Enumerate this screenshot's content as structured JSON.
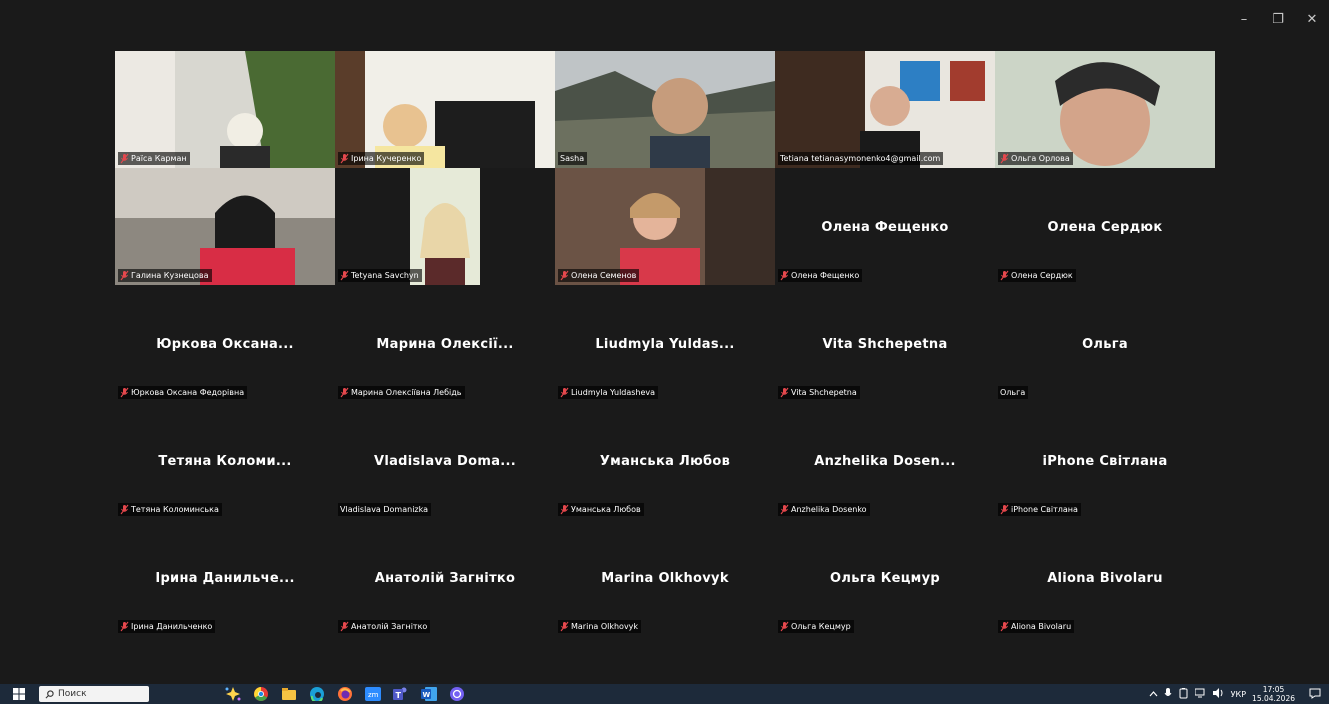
{
  "window_controls": {
    "minimize": "–",
    "restore": "❐",
    "close": "✕"
  },
  "tiles": [
    {
      "label": "Раїса Карман",
      "video": true,
      "muted": true
    },
    {
      "label": "Ірина Кучеренко",
      "video": true,
      "muted": true
    },
    {
      "label": "Sasha",
      "video": true,
      "muted": false,
      "active": true
    },
    {
      "label": "Tetiana tetianasymonenko4@gmail.com",
      "video": true,
      "muted": false
    },
    {
      "label": "Ольга Орлова",
      "video": true,
      "muted": true
    },
    {
      "label": "Галина Кузнецова",
      "video": true,
      "muted": true
    },
    {
      "label": "Tetyana Savchyn",
      "video": true,
      "muted": true
    },
    {
      "label": "Олена Семенов",
      "video": true,
      "muted": true
    },
    {
      "label": "Олена Фещенко",
      "display": "Олена Фещенко",
      "video": false,
      "muted": true
    },
    {
      "label": "Олена Сердюк",
      "display": "Олена Сердюк",
      "video": false,
      "muted": true
    },
    {
      "label": "Юркова Оксана Федорівна",
      "display": "Юркова Оксана...",
      "video": false,
      "muted": true
    },
    {
      "label": "Марина Олексіївна Лебідь",
      "display": "Марина Олексії...",
      "video": false,
      "muted": true
    },
    {
      "label": "Liudmyla Yuldasheva",
      "display": "Liudmyla Yuldas...",
      "video": false,
      "muted": true
    },
    {
      "label": "Vita Shchepetna",
      "display": "Vita Shchepetna",
      "video": false,
      "muted": true
    },
    {
      "label": "Ольга",
      "display": "Ольга",
      "video": false,
      "muted": false
    },
    {
      "label": "Тетяна Коломинська",
      "display": "Тетяна Коломи...",
      "video": false,
      "muted": true
    },
    {
      "label": "Vladislava Domanizka",
      "display": "Vladislava Doma...",
      "video": false,
      "muted": false
    },
    {
      "label": "Уманська Любов",
      "display": "Уманська Любов",
      "video": false,
      "muted": true
    },
    {
      "label": "Anzhelika Dosenko",
      "display": "Anzhelika Dosen...",
      "video": false,
      "muted": true
    },
    {
      "label": "iPhone Світлана",
      "display": "iPhone Світлана",
      "video": false,
      "muted": true
    },
    {
      "label": "Ірина Данильченко",
      "display": "Ірина Данильче...",
      "video": false,
      "muted": true
    },
    {
      "label": "Анатолій Загнітко",
      "display": "Анатолій Загнітко",
      "video": false,
      "muted": true
    },
    {
      "label": "Marina Olkhovyk",
      "display": "Marina Olkhovyk",
      "video": false,
      "muted": true
    },
    {
      "label": "Ольга Кецмур",
      "display": "Ольга Кецмур",
      "video": false,
      "muted": true
    },
    {
      "label": "Aliona Bivolaru",
      "display": "Aliona Bivolaru",
      "video": false,
      "muted": true
    }
  ],
  "taskbar": {
    "search_placeholder": "Поиск",
    "apps": [
      "windows-start-icon",
      "copilot-icon",
      "chrome-icon",
      "file-explorer-icon",
      "edge-icon",
      "firefox-icon",
      "zoom-icon",
      "teams-icon",
      "word-icon",
      "viber-icon"
    ],
    "tray": {
      "language": "УКР",
      "time": "17:05",
      "date": "15.04.2026"
    }
  },
  "colors": {
    "active_border": "#23d959",
    "mute_icon": "#e5484d",
    "background": "#1a1a1a",
    "taskbar": "#1d2a3a"
  }
}
